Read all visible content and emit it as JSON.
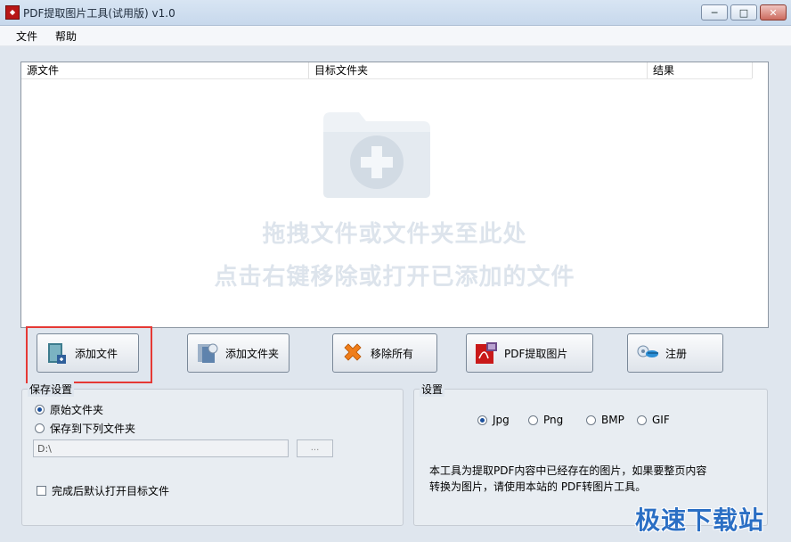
{
  "window": {
    "title": "PDF提取图片工具(试用版) v1.0",
    "controls": [
      "minimize-icon",
      "maximize-icon",
      "close-icon"
    ]
  },
  "menu": {
    "file": "文件",
    "help": "帮助"
  },
  "table": {
    "columns": [
      "源文件",
      "目标文件夹",
      "结果"
    ]
  },
  "drop_zone": {
    "line1": "拖拽文件或文件夹至此处",
    "line2": "点击右键移除或打开已添加的文件"
  },
  "buttons": {
    "add_file": "添加文件",
    "add_folder": "添加文件夹",
    "remove_all": "移除所有",
    "extract": "PDF提取图片",
    "register": "注册"
  },
  "save_settings": {
    "title": "保存设置",
    "option_original": "原始文件夹",
    "option_custom": "保存到下列文件夹",
    "path_value": "D:\\",
    "browse_label": "...",
    "open_after": "完成后默认打开目标文件"
  },
  "settings": {
    "title": "设置",
    "formats": [
      "Jpg",
      "Png",
      "BMP",
      "GIF"
    ],
    "selected_format": "Jpg",
    "description_line1": "本工具为提取PDF内容中已经存在的图片，如果要整页内容",
    "description_line2": "转换为图片，请使用本站的 PDF转图片工具。"
  },
  "watermark": "极速下载站",
  "colors": {
    "accent": "#2b6fc4",
    "highlight": "#e53935"
  }
}
